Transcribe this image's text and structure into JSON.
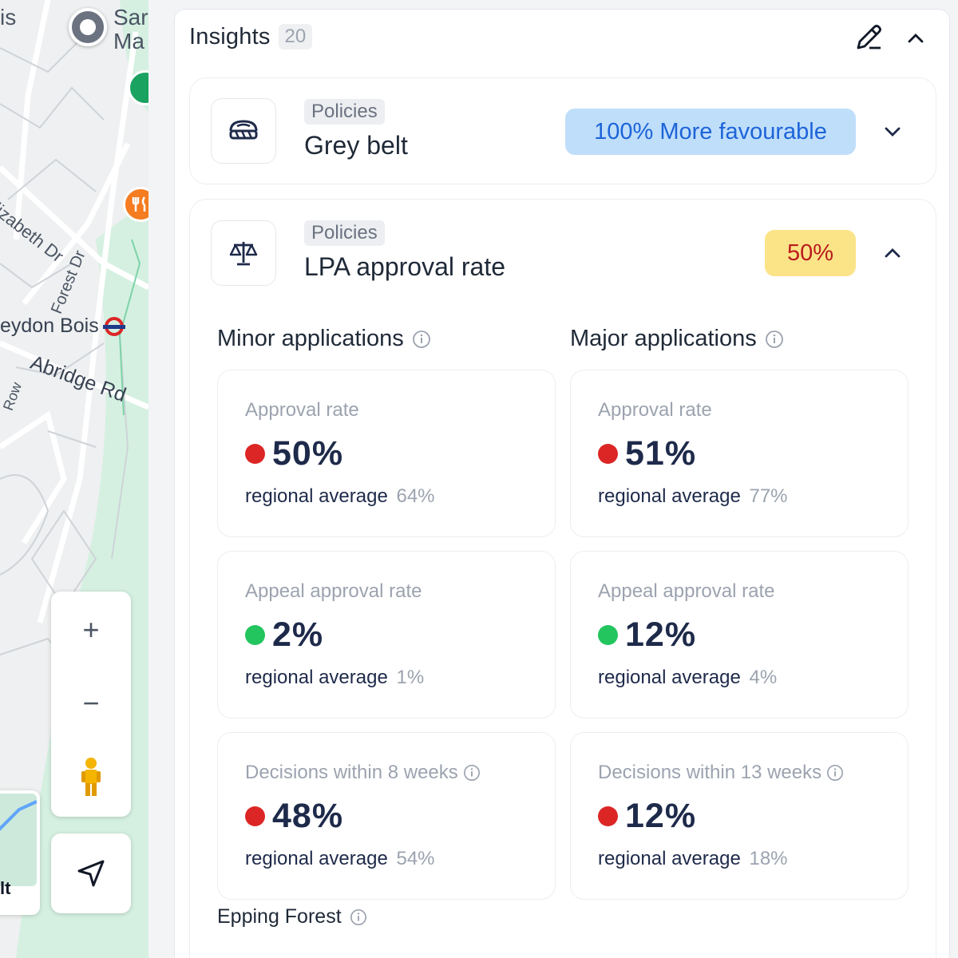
{
  "map": {
    "labels": {
      "is": "is",
      "sar": "Sar",
      "ma": "Ma",
      "elizabeth": "Elizabeth Dr",
      "forest": "Forest Dr",
      "station": "eydon Bois",
      "abridge": "Abridge Rd",
      "row": "Row",
      "lt": "lt"
    },
    "zoom_in": "+",
    "zoom_out": "−"
  },
  "panel": {
    "title": "Insights",
    "count": "20"
  },
  "cards": {
    "greybelt": {
      "tag": "Policies",
      "name": "Grey belt",
      "pill": "100% More favourable",
      "pill_color": "#bfdefa"
    },
    "lpa": {
      "tag": "Policies",
      "name": "LPA approval rate",
      "pill": "50%",
      "pill_color": "#fbe488",
      "minor": {
        "heading": "Minor applications",
        "approval": {
          "label": "Approval rate",
          "value": "50%",
          "status": "red",
          "avg_label": "regional average",
          "avg": "64%"
        },
        "appeal": {
          "label": "Appeal approval rate",
          "value": "2%",
          "status": "green",
          "avg_label": "regional average",
          "avg": "1%"
        },
        "decisions": {
          "label": "Decisions within 8 weeks",
          "value": "48%",
          "status": "red",
          "avg_label": "regional average",
          "avg": "54%"
        }
      },
      "major": {
        "heading": "Major applications",
        "approval": {
          "label": "Approval rate",
          "value": "51%",
          "status": "red",
          "avg_label": "regional average",
          "avg": "77%"
        },
        "appeal": {
          "label": "Appeal approval rate",
          "value": "12%",
          "status": "green",
          "avg_label": "regional average",
          "avg": "4%"
        },
        "decisions": {
          "label": "Decisions within 13 weeks",
          "value": "12%",
          "status": "red",
          "avg_label": "regional average",
          "avg": "18%"
        }
      },
      "footer": "Epping Forest"
    }
  },
  "colors": {
    "red": "#dc2626",
    "green": "#22c55e",
    "navy": "#1e2a4a"
  }
}
